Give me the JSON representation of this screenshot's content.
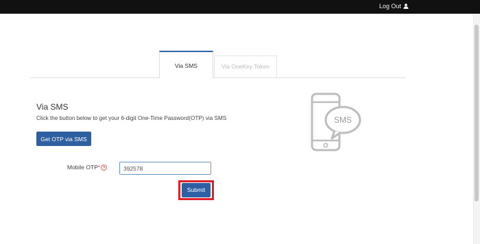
{
  "header": {
    "logout_label": "Log Out",
    "logout_icon": "user-icon"
  },
  "tabs": [
    {
      "label": "Via SMS",
      "active": true
    },
    {
      "label": "Via OneKey Token",
      "active": false
    }
  ],
  "sms_section": {
    "title": "Via SMS",
    "description": "Click the button below to get your 6-digit One-Time Password(OTP) via SMS",
    "get_otp_label": "Get OTP via SMS",
    "illustration_icon": "phone-sms-icon",
    "illustration_text": "SMS"
  },
  "form": {
    "otp_label": "Mobile OTP",
    "required_marker": "*",
    "help_icon": "question-circle-icon",
    "otp_value": "392578",
    "submit_label": "Submit"
  },
  "colors": {
    "topbar": "#111111",
    "primary_button": "#2f5fa3",
    "active_tab_accent": "#2f63a8",
    "highlight_box": "#e0202a",
    "required": "#d9534f"
  }
}
